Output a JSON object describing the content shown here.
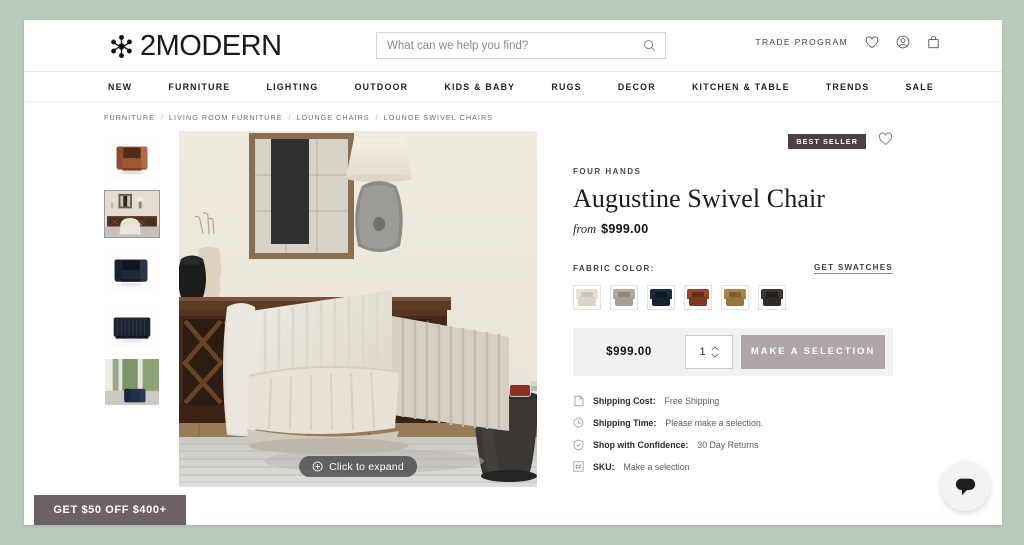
{
  "header": {
    "logo_text": "2MODERN",
    "logo_icon": "asterisk-star-logo-icon",
    "search": {
      "placeholder": "What can we help you find?",
      "value": "",
      "icon": "search-icon"
    },
    "trade_program": "TRADE PROGRAM",
    "icons": {
      "wishlist": "heart-icon",
      "account": "user-circle-icon",
      "cart": "bag-icon"
    }
  },
  "nav": {
    "items": [
      {
        "label": "NEW"
      },
      {
        "label": "FURNITURE"
      },
      {
        "label": "LIGHTING"
      },
      {
        "label": "OUTDOOR"
      },
      {
        "label": "KIDS & BABY"
      },
      {
        "label": "RUGS"
      },
      {
        "label": "DECOR"
      },
      {
        "label": "KITCHEN & TABLE"
      },
      {
        "label": "TRENDS"
      },
      {
        "label": "SALE"
      }
    ]
  },
  "breadcrumb": {
    "separator": "/",
    "items": [
      {
        "label": "FURNITURE"
      },
      {
        "label": "LIVING ROOM FURNITURE"
      },
      {
        "label": "LOUNGE CHAIRS"
      },
      {
        "label": "LOUNGE SWIVEL CHAIRS"
      }
    ]
  },
  "gallery": {
    "thumbnails": [
      {
        "name": "thumb-cognac-leather-chair",
        "active": false,
        "type": "chair",
        "color": "#9c5a3c",
        "shade": "#7c4128"
      },
      {
        "name": "thumb-room-scene",
        "active": true,
        "type": "scene",
        "color": "#cfc4b4",
        "shade": "#6b4b33"
      },
      {
        "name": "thumb-navy-chair-angle",
        "active": false,
        "type": "chair",
        "color": "#22293a",
        "shade": "#161c2a"
      },
      {
        "name": "thumb-navy-chair-back",
        "active": false,
        "type": "chair",
        "color": "#1d2430",
        "shade": "#141923"
      },
      {
        "name": "thumb-navy-chair-lifestyle",
        "active": false,
        "type": "scene2",
        "color": "#3a4a52",
        "shade": "#1f3a4a"
      }
    ],
    "hero_alt": "Augustine Swivel Chair in cream fabric in a styled living room",
    "expand_label": "Click to expand",
    "expand_icon": "plus-circle-icon"
  },
  "product": {
    "badge": "BEST SELLER",
    "wishlist_icon": "heart-icon",
    "brand": "FOUR HANDS",
    "title": "Augustine Swivel Chair",
    "price_prefix": "from",
    "price": "$999.00",
    "fabric_color_label": "FABRIC COLOR:",
    "get_swatches_label": "GET SWATCHES",
    "swatches": [
      {
        "name": "swatch-ivory-linen",
        "back": "#e7e1d6",
        "seat": "#dcd5c7",
        "inner": "#cfc7b6"
      },
      {
        "name": "swatch-taupe-grey",
        "back": "#b2aba1",
        "seat": "#a69e94",
        "inner": "#8f877c"
      },
      {
        "name": "swatch-navy-blue",
        "back": "#1e2b3d",
        "seat": "#16202e",
        "inner": "#0f1926"
      },
      {
        "name": "swatch-cognac-leather",
        "back": "#96472c",
        "seat": "#7d3a22",
        "inner": "#62301c"
      },
      {
        "name": "swatch-camel-tan",
        "back": "#a8854f",
        "seat": "#96743f",
        "inner": "#7d5f32"
      },
      {
        "name": "swatch-espresso-dark",
        "back": "#3d3632",
        "seat": "#2f2a27",
        "inner": "#241f1d"
      }
    ]
  },
  "purchase": {
    "price": "$999.00",
    "quantity": "1",
    "quantity_up_icon": "chevron-up-icon",
    "quantity_down_icon": "chevron-down-icon",
    "cta_label": "MAKE A SELECTION"
  },
  "meta_rows": [
    {
      "icon": "document-icon",
      "key": "Shipping Cost:",
      "value": "Free Shipping"
    },
    {
      "icon": "clock-icon",
      "key": "Shipping Time:",
      "value": "Please make a selection."
    },
    {
      "icon": "shield-check-icon",
      "key": "Shop with Confidence:",
      "value": "30 Day Returns"
    },
    {
      "icon": "hash-icon",
      "key": "SKU:",
      "value": "Make a selection"
    }
  ],
  "promo": {
    "label": "GET $50 OFF $400+"
  },
  "chat": {
    "icon": "chat-bubble-icon"
  },
  "colors": {
    "page_background": "#b9cbbc",
    "badge": "#4d4048",
    "cta": "#aea6a8",
    "promo": "#6d6167",
    "purchase_bar": "#f2f0f0"
  }
}
